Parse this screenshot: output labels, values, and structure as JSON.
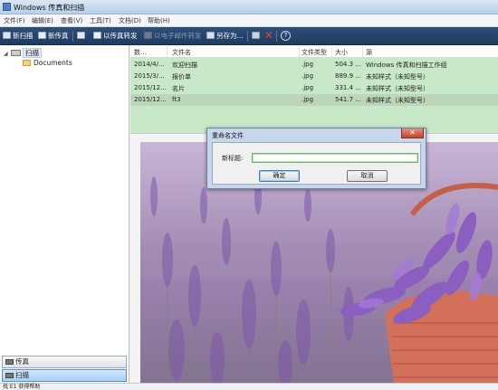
{
  "window": {
    "title": "Windows 传真和扫描"
  },
  "menu": [
    "文件(F)",
    "编辑(E)",
    "查看(V)",
    "工具(T)",
    "文档(D)",
    "帮助(H)"
  ],
  "toolbar": {
    "new_scan": "新扫描",
    "new_fax": "新传真",
    "send_as_fax": "以传真转发",
    "send_as_email": "以电子邮件转发",
    "save_as": "另存为..."
  },
  "tree": {
    "root": "扫描",
    "child": "Documents"
  },
  "nav": {
    "fax": "传真",
    "scan": "扫描"
  },
  "list": {
    "columns": [
      "数...",
      "文件名",
      "文件类型",
      "大小",
      "源"
    ],
    "rows": [
      {
        "date": "2014/4/...",
        "name": "欢迎扫描",
        "type": ".jpg",
        "size": "504.3 ...",
        "source": "Windows 传真和扫描工作组"
      },
      {
        "date": "2015/3/...",
        "name": "报价单",
        "type": ".jpg",
        "size": "889.9 ...",
        "source": "未知样式（未知型号）"
      },
      {
        "date": "2015/12...",
        "name": "名片",
        "type": ".jpg",
        "size": "331.4 ...",
        "source": "未知样式（未知型号）"
      },
      {
        "date": "2015/12...",
        "name": "ft3",
        "type": ".jpg",
        "size": "541.7 ...",
        "source": "未知样式（未知型号）"
      }
    ]
  },
  "dialog": {
    "title": "重命名文件",
    "label": "新标题:",
    "value": "",
    "ok": "确定",
    "cancel": "取消"
  },
  "status": {
    "text": "找 E1 获得帮助"
  },
  "colors": {
    "toolbar": "#2a4770",
    "list_bg": "#c8e9c8",
    "lavender": "#8b5fc0",
    "basket": "#d2705a"
  }
}
